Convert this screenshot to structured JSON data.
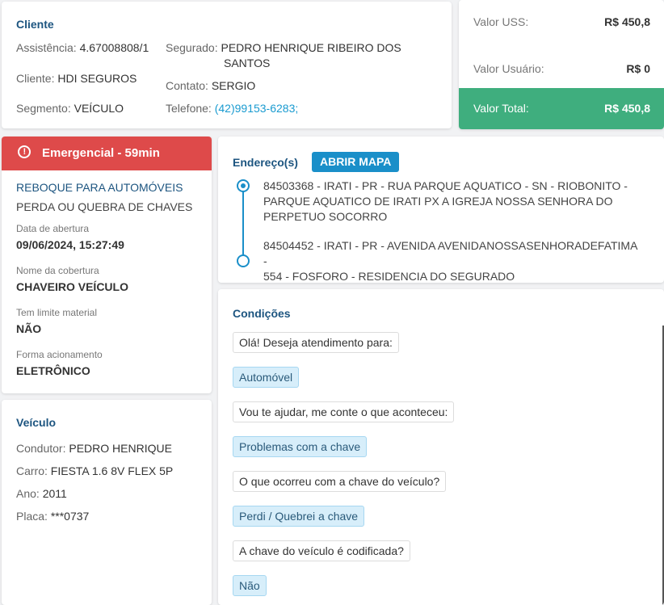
{
  "cliente": {
    "title": "Cliente",
    "assistencia_label": "Assistência:",
    "assistencia_value": "4.67008808/1",
    "cliente_label": "Cliente:",
    "cliente_value": "HDI SEGUROS",
    "segmento_label": "Segmento:",
    "segmento_value": "VEÍCULO",
    "segurado_label": "Segurado:",
    "segurado_value_1": "PEDRO HENRIQUE RIBEIRO DOS",
    "segurado_value_2": "SANTOS",
    "contato_label": "Contato:",
    "contato_value": "SERGIO",
    "telefone_label": "Telefone:",
    "telefone_value": "(42)99153-6283;"
  },
  "valores": {
    "uss_label": "Valor USS:",
    "uss_value": "R$ 450,8",
    "usuario_label": "Valor Usuário:",
    "usuario_value": "R$ 0",
    "total_label": "Valor Total:",
    "total_value": "R$ 450,8",
    "total_color": "#3fae7e"
  },
  "emergencia": {
    "badge": "Emergencial - 59min",
    "badge_icon": "info-icon",
    "badge_color": "#de4a4a",
    "servico": "REBOQUE PARA AUTOMÓVEIS",
    "motivo": "PERDA OU QUEBRA DE CHAVES",
    "abertura_label": "Data de abertura",
    "abertura_value": "09/06/2024, 15:27:49",
    "cobertura_label": "Nome da cobertura",
    "cobertura_value": "CHAVEIRO VEÍCULO",
    "limite_label": "Tem limite material",
    "limite_value": "NÃO",
    "acionamento_label": "Forma acionamento",
    "acionamento_value": "ELETRÔNICO"
  },
  "veiculo": {
    "title": "Veículo",
    "condutor_label": "Condutor:",
    "condutor_value": "PEDRO HENRIQUE",
    "carro_label": "Carro:",
    "carro_value": "FIESTA 1.6 8V FLEX 5P",
    "ano_label": "Ano:",
    "ano_value": "2011",
    "placa_label": "Placa:",
    "placa_value": "***0737"
  },
  "endereco": {
    "title": "Endereço(s)",
    "map_button": "ABRIR MAPA",
    "addr1_line1": "84503368 - IRATI - PR - RUA PARQUE AQUATICO - SN - RIOBONITO -",
    "addr1_line2": "PARQUE AQUATICO DE IRATI PX A IGREJA NOSSA SENHORA DO",
    "addr1_line3": "PERPETUO SOCORRO",
    "addr2_line1": "84504452 - IRATI - PR - AVENIDA AVENIDANOSSASENHORADEFATIMA -",
    "addr2_line2": "554 - FOSFORO - RESIDENCIA DO SEGURADO"
  },
  "condicoes": {
    "title": "Condições",
    "q1": "Olá! Deseja atendimento para:",
    "a1": "Automóvel",
    "q2": "Vou te ajudar, me conte o que aconteceu:",
    "a2": "Problemas com a chave",
    "q3": "O que ocorreu com a chave do veículo?",
    "a3": "Perdi / Quebrei a chave",
    "q4": "A chave do veículo é codificada?",
    "a4": "Não"
  }
}
